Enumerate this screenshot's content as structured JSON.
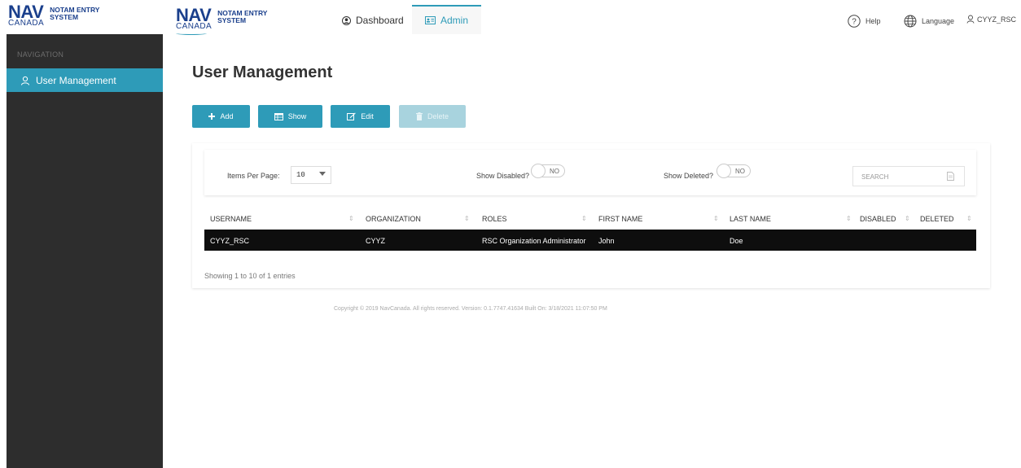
{
  "brand": {
    "logo_word": "NAV",
    "logo_country": "CANADA",
    "logo_line1": "NOTAM ENTRY",
    "logo_line2": "SYSTEM",
    "primary_color": "#2e9bb8",
    "brand_color": "#1a3f8c"
  },
  "sidebar": {
    "heading": "NAVIGATION",
    "items": [
      {
        "label": "User Management",
        "icon": "user-icon",
        "active": true
      }
    ]
  },
  "topnav": {
    "tabs": [
      {
        "label": "Dashboard",
        "icon": "dashboard-icon"
      },
      {
        "label": "Admin",
        "icon": "id-card-icon",
        "active": true
      }
    ],
    "help": "Help",
    "language": "Language",
    "user": "CYYZ_RSC"
  },
  "page": {
    "title": "User Management"
  },
  "toolbar": {
    "add": "Add",
    "show": "Show",
    "edit": "Edit",
    "delete": "Delete"
  },
  "filters": {
    "items_per_page_label": "Items Per Page:",
    "items_per_page_value": "10",
    "show_disabled_label": "Show Disabled?",
    "show_disabled_value": "NO",
    "show_deleted_label": "Show Deleted?",
    "show_deleted_value": "NO",
    "search_placeholder": "SEARCH"
  },
  "table": {
    "columns": [
      "USERNAME",
      "ORGANIZATION",
      "ROLES",
      "FIRST NAME",
      "LAST NAME",
      "DISABLED",
      "DELETED"
    ],
    "rows": [
      [
        "CYYZ_RSC",
        "CYYZ",
        "RSC Organization Administrator",
        "John",
        "Doe",
        "",
        ""
      ]
    ],
    "summary": "Showing 1 to 10 of 1 entries"
  },
  "footer": {
    "text": "Copyright © 2019 NavCanada. All rights reserved. Version: 0.1.7747.41634 Built On: 3/18/2021 11:07:50 PM"
  }
}
